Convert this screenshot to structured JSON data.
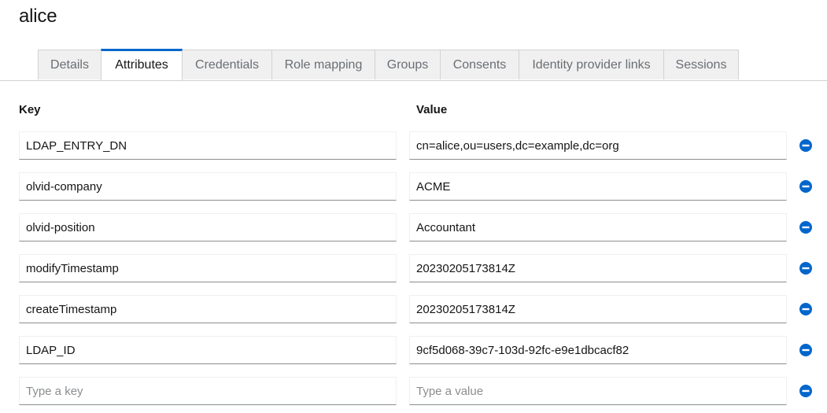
{
  "user": {
    "name": "alice"
  },
  "tabs": [
    {
      "label": "Details"
    },
    {
      "label": "Attributes"
    },
    {
      "label": "Credentials"
    },
    {
      "label": "Role mapping"
    },
    {
      "label": "Groups"
    },
    {
      "label": "Consents"
    },
    {
      "label": "Identity provider links"
    },
    {
      "label": "Sessions"
    }
  ],
  "active_tab": "Attributes",
  "columns": {
    "key": "Key",
    "value": "Value"
  },
  "attributes": [
    {
      "key": "LDAP_ENTRY_DN",
      "value": "cn=alice,ou=users,dc=example,dc=org"
    },
    {
      "key": "olvid-company",
      "value": "ACME"
    },
    {
      "key": "olvid-position",
      "value": "Accountant"
    },
    {
      "key": "modifyTimestamp",
      "value": "20230205173814Z"
    },
    {
      "key": "createTimestamp",
      "value": "20230205173814Z"
    },
    {
      "key": "LDAP_ID",
      "value": "9cf5d068-39c7-103d-92fc-e9e1dbcacf82"
    }
  ],
  "new_row": {
    "key_placeholder": "Type a key",
    "value_placeholder": "Type a value"
  },
  "icons": {
    "remove": "minus-circle-icon"
  },
  "colors": {
    "accent": "#0066cc",
    "tab_inactive_bg": "#f0f0f0",
    "border": "#d2d2d2"
  }
}
